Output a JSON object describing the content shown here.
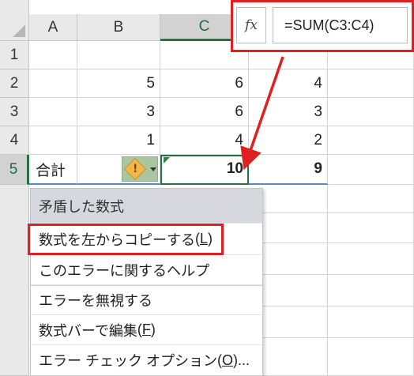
{
  "columns": [
    "A",
    "B",
    "C"
  ],
  "rows": [
    "1",
    "2",
    "3",
    "4",
    "5"
  ],
  "cells": {
    "b2": "5",
    "c2": "6",
    "d2": "4",
    "b3": "3",
    "c3": "6",
    "d3": "3",
    "b4": "1",
    "c4": "4",
    "d4": "2",
    "a5": "合計",
    "c5": "10",
    "d5": "9"
  },
  "formula_bar": {
    "fx_label": "fx",
    "formula": "=SUM(C3:C4)"
  },
  "error_menu": {
    "title": "矛盾した数式",
    "copy_from_left": "数式を左からコピーする",
    "copy_from_left_key": "L",
    "help": "このエラーに関するヘルプ",
    "ignore": "エラーを無視する",
    "edit_in_bar": "数式バーで編集",
    "edit_in_bar_key": "F",
    "options": "エラー チェック オプション",
    "options_key": "O",
    "options_suffix": "..."
  },
  "colors": {
    "highlight_red": "#e02020",
    "excel_green": "#217346",
    "warning_icon": "#f1b849"
  },
  "icons": {
    "fx": "function-icon",
    "warning": "warning-diamond-icon",
    "dropdown": "chevron-down-icon"
  }
}
